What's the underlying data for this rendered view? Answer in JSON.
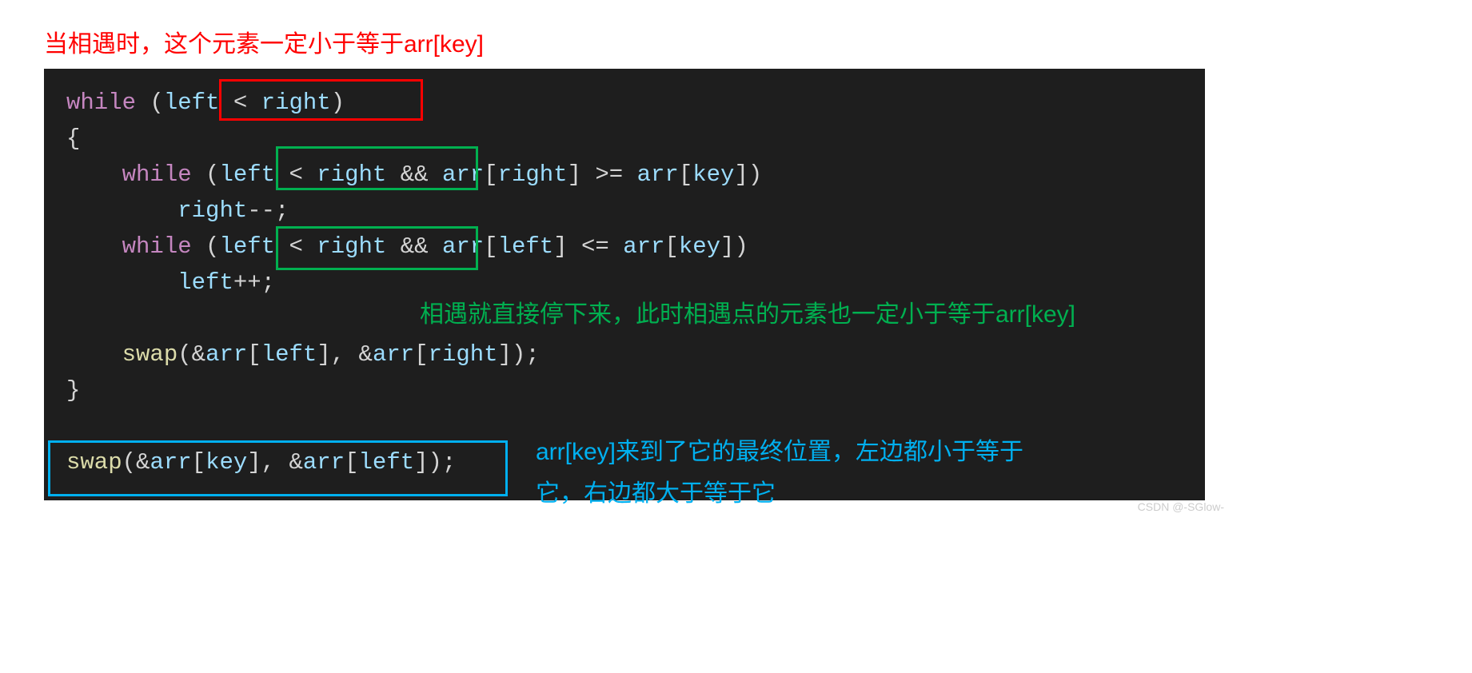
{
  "annotations": {
    "top_red": "当相遇时，这个元素一定小于等于arr[key]",
    "green_inline": "相遇就直接停下来，此时相遇点的元素也一定小于等于arr[key]",
    "blue_line1": "arr[key]来到了它的最终位置，左边都小于等于",
    "blue_line2": "它，右边都大于等于它"
  },
  "code": {
    "l1": {
      "while": "while",
      "lp": " (",
      "left": "left",
      "lt": " < ",
      "right": "right",
      "rp": ")"
    },
    "l2": {
      "brace": "{"
    },
    "l3": {
      "pad": "    ",
      "while": "while",
      "lp": " (",
      "left": "left",
      "lt": " < ",
      "right": "right",
      "and": " && ",
      "arr1": "arr",
      "br1": "[",
      "idx1": "right",
      "br2": "] >= ",
      "arr2": "arr",
      "br3": "[",
      "key": "key",
      "br4": "])"
    },
    "l4": {
      "pad": "        ",
      "right": "right",
      "dec": "--;"
    },
    "l5": {
      "pad": "    ",
      "while": "while",
      "lp": " (",
      "left": "left",
      "lt": " < ",
      "right": "right",
      "and": " && ",
      "arr1": "arr",
      "br1": "[",
      "idx1": "left",
      "br2": "] <= ",
      "arr2": "arr",
      "br3": "[",
      "key": "key",
      "br4": "])"
    },
    "l6": {
      "pad": "        ",
      "left": "left",
      "inc": "++;"
    },
    "l8": {
      "pad": "    ",
      "swap": "swap",
      "lp": "(&",
      "arr1": "arr",
      "b1": "[",
      "left": "left",
      "b2": "], &",
      "arr2": "arr",
      "b3": "[",
      "right": "right",
      "b4": "]);"
    },
    "l9": {
      "brace": "}"
    },
    "l11": {
      "swap": "swap",
      "lp": "(&",
      "arr1": "arr",
      "b1": "[",
      "key": "key",
      "b2": "], &",
      "arr2": "arr",
      "b3": "[",
      "left": "left",
      "b4": "]);"
    }
  },
  "watermark": "CSDN @-SGlow-"
}
